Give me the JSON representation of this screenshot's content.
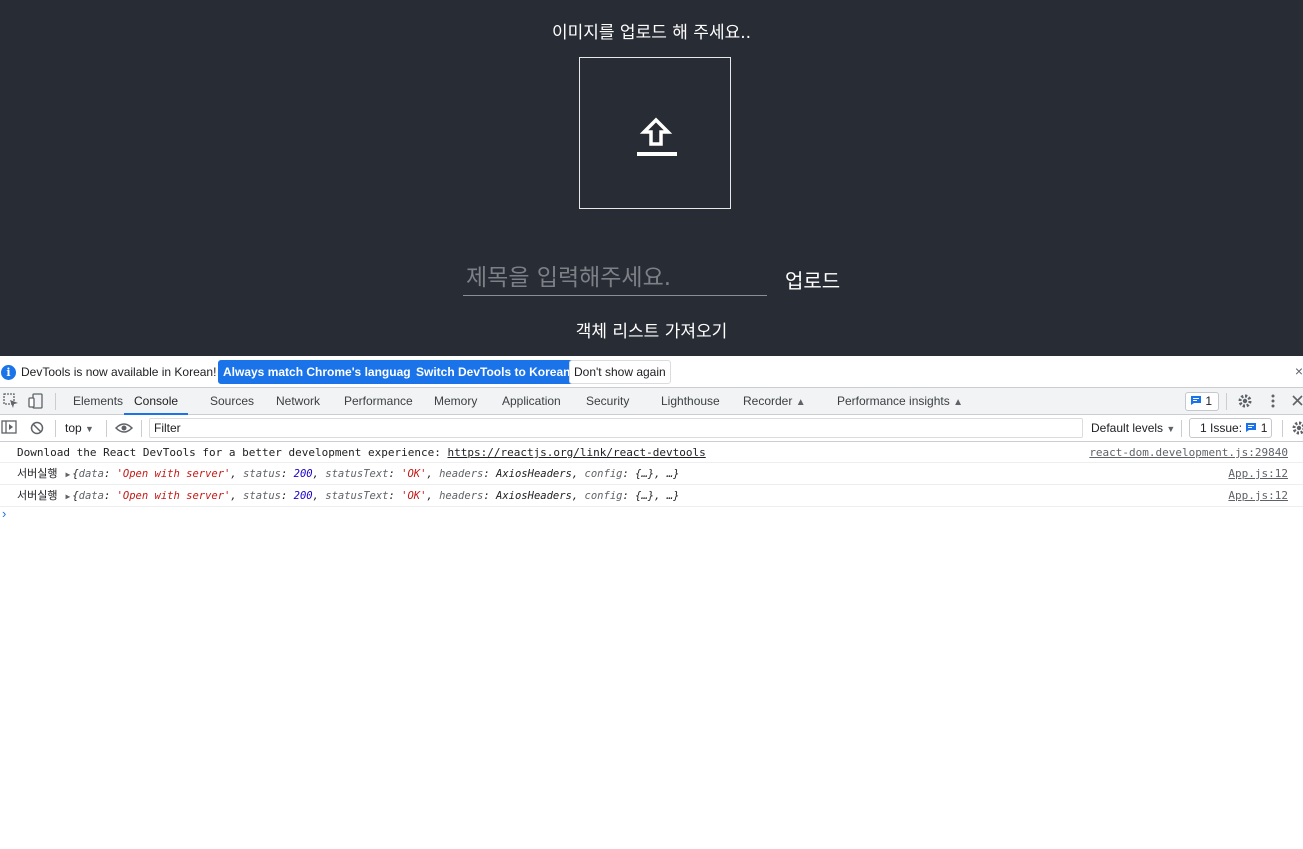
{
  "app": {
    "title": "이미지를 업로드 해 주세요..",
    "upload_icon": "upload-arrow-icon",
    "title_input": {
      "placeholder": "제목을 입력해주세요.",
      "value": ""
    },
    "upload_label": "업로드",
    "list_label": "객체 리스트 가져오기"
  },
  "devtools": {
    "infobar": {
      "message": "DevTools is now available in Korean!",
      "match_language": "Always match Chrome's language",
      "switch_korean": "Switch DevTools to Korean",
      "dont_show": "Don't show again",
      "close": "×"
    },
    "tabs": [
      "Elements",
      "Console",
      "Sources",
      "Network",
      "Performance",
      "Memory",
      "Application",
      "Security",
      "Lighthouse",
      "Recorder",
      "Performance insights"
    ],
    "active_tab": "Console",
    "message_count": "1",
    "filterbar": {
      "context": "top",
      "filter_placeholder": "Filter",
      "levels": "Default levels",
      "issues_label": "1 Issue:",
      "issues_count": "1"
    },
    "console": {
      "rows": [
        {
          "text": "Download the React DevTools for a better development experience: ",
          "link": "https://reactjs.org/link/react-devtools",
          "source": "react-dom.development.js:29840"
        },
        {
          "label": "서버실행",
          "data_key": "data",
          "data_val": "'Open with server'",
          "status_key": "status",
          "status_val": "200",
          "statusText_key": "statusText",
          "statusText_val": "'OK'",
          "headers_key": "headers",
          "headers_val": "AxiosHeaders",
          "config_key": "config",
          "config_val": "{…}",
          "tail": "…",
          "source": "App.js:12"
        },
        {
          "label": "서버실행",
          "data_key": "data",
          "data_val": "'Open with server'",
          "status_key": "status",
          "status_val": "200",
          "statusText_key": "statusText",
          "statusText_val": "'OK'",
          "headers_key": "headers",
          "headers_val": "AxiosHeaders",
          "config_key": "config",
          "config_val": "{…}",
          "tail": "…",
          "source": "App.js:12"
        }
      ],
      "prompt": "›"
    }
  }
}
